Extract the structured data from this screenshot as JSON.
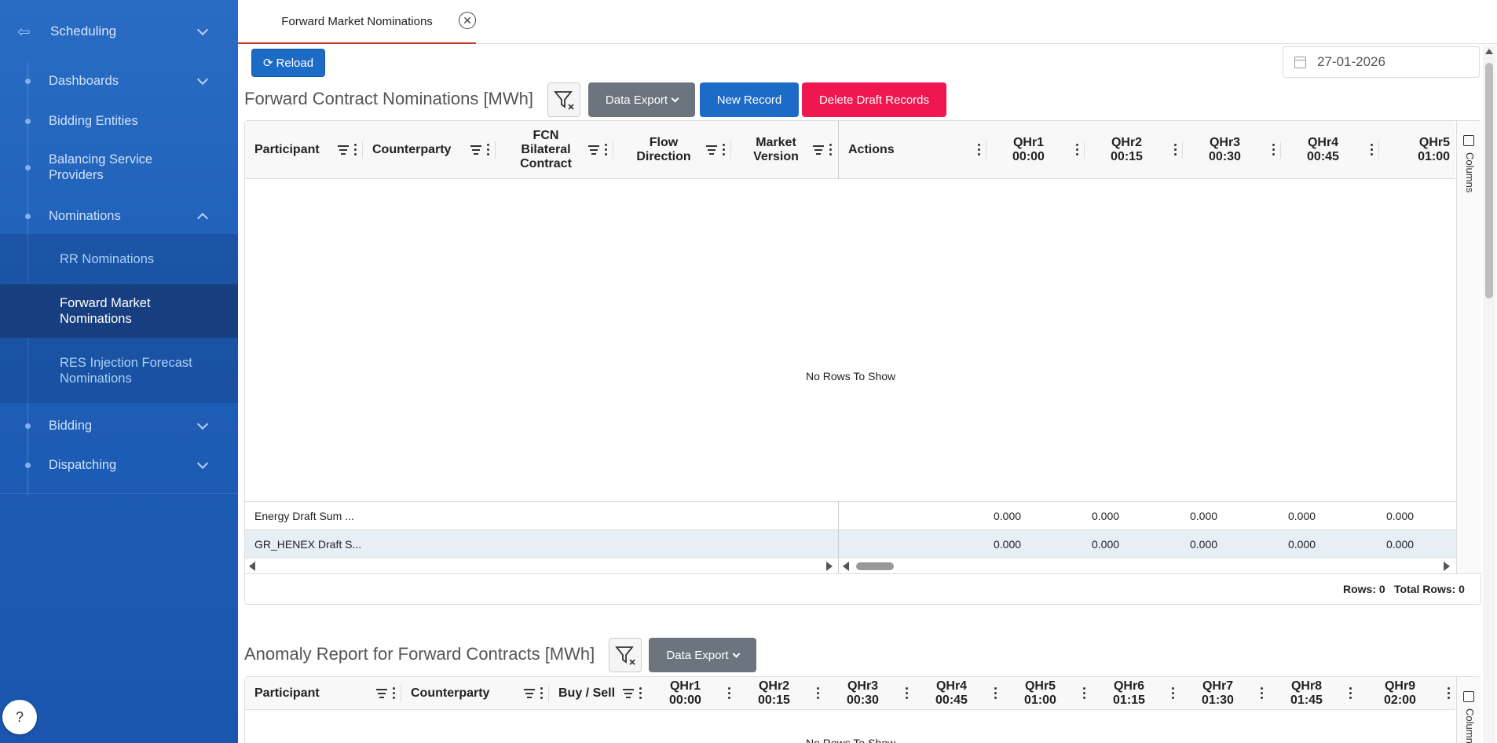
{
  "sidebar": {
    "top_label": "Scheduling",
    "items": [
      {
        "label": "Dashboards",
        "expandable": true
      },
      {
        "label": "Bidding Entities",
        "expandable": false
      },
      {
        "label": "Balancing Service Providers",
        "expandable": false
      },
      {
        "label": "Nominations",
        "expandable": true,
        "expanded": true
      }
    ],
    "nominations_children": [
      {
        "label": "RR Nominations"
      },
      {
        "label": "Forward Market Nominations",
        "active": true
      },
      {
        "label": "RES Injection Forecast Nominations"
      }
    ],
    "items_after": [
      {
        "label": "Bidding",
        "expandable": true
      },
      {
        "label": "Dispatching",
        "expandable": true
      }
    ],
    "help_label": "?"
  },
  "tabs": [
    {
      "label": "Forward Market Nominations",
      "active": true
    }
  ],
  "toolbar": {
    "reload_label": "Reload",
    "date_value": "27-01-2026"
  },
  "fcn": {
    "title": "Forward Contract Nominations [MWh]",
    "data_export_label": "Data Export",
    "new_record_label": "New Record",
    "delete_draft_label": "Delete Draft Records",
    "columns": {
      "participant": "Participant",
      "counterparty": "Counterparty",
      "fcn_bilateral": "FCN Bilateral Contract",
      "flow_direction": "Flow Direction",
      "market_version": "Market Version",
      "actions": "Actions",
      "qhr": [
        {
          "label": "QHr1",
          "time": "00:00"
        },
        {
          "label": "QHr2",
          "time": "00:15"
        },
        {
          "label": "QHr3",
          "time": "00:30"
        },
        {
          "label": "QHr4",
          "time": "00:45"
        },
        {
          "label": "QHr5",
          "time": "01:00"
        }
      ]
    },
    "no_rows": "No Rows To Show",
    "footer_rows": [
      {
        "label": "Energy Draft Sum ...",
        "values": [
          "0.000",
          "0.000",
          "0.000",
          "0.000",
          "0.000"
        ]
      },
      {
        "label": "GR_HENEX Draft S...",
        "values": [
          "0.000",
          "0.000",
          "0.000",
          "0.000",
          "0.000"
        ]
      }
    ],
    "side_panel_label": "Columns",
    "status": {
      "rows": "Rows: 0",
      "total_rows": "Total Rows: 0"
    }
  },
  "anomaly": {
    "title": "Anomaly Report for Forward Contracts [MWh]",
    "data_export_label": "Data Export",
    "columns": {
      "participant": "Participant",
      "counterparty": "Counterparty",
      "buy_sell": "Buy / Sell",
      "qhr": [
        {
          "label": "QHr1",
          "time": "00:00"
        },
        {
          "label": "QHr2",
          "time": "00:15"
        },
        {
          "label": "QHr3",
          "time": "00:30"
        },
        {
          "label": "QHr4",
          "time": "00:45"
        },
        {
          "label": "QHr5",
          "time": "01:00"
        },
        {
          "label": "QHr6",
          "time": "01:15"
        },
        {
          "label": "QHr7",
          "time": "01:30"
        },
        {
          "label": "QHr8",
          "time": "01:45"
        },
        {
          "label": "QHr9",
          "time": "02:00"
        }
      ]
    },
    "no_rows": "No Rows To Show",
    "side_panel_label": "Columns"
  },
  "colors": {
    "sidebar_top": "#2a6cc4",
    "sidebar_active": "#173f7f",
    "primary": "#1c6bc6",
    "danger": "#f0164f",
    "secondary": "#6c757d",
    "tab_underline": "#c0392b"
  }
}
